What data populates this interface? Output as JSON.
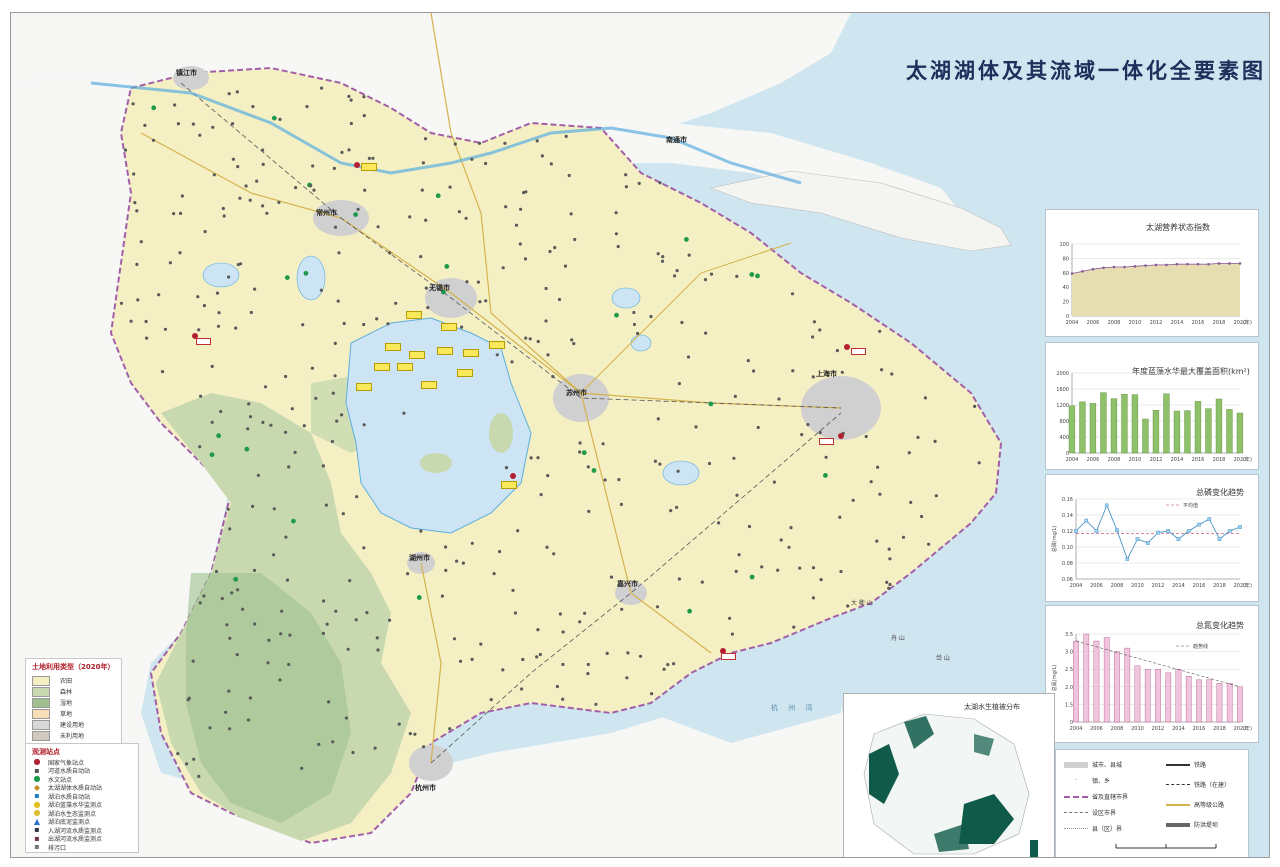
{
  "map": {
    "title": "太湖湖体及其流域一体化全要素图",
    "colors": {
      "sea": "#cfe5f0",
      "farmland": "#f5f0c4",
      "forest": "#c8d9b0",
      "forest_dark": "#9fbf8f",
      "water": "#cde4f4",
      "urban": "#d0d0d0",
      "outside": "#f7f7f5",
      "boundary": "#a25fa8",
      "road": "#d4b24c",
      "point_dark": "#5a5a5a",
      "point_green": "#1f9a4a",
      "point_red": "#b22030"
    },
    "places": [
      {
        "name": "镇江市",
        "kind": "city"
      },
      {
        "name": "常州市",
        "kind": "city"
      },
      {
        "name": "无锡市",
        "kind": "city"
      },
      {
        "name": "苏州市",
        "kind": "city"
      },
      {
        "name": "上海市",
        "kind": "city"
      },
      {
        "name": "湖州市",
        "kind": "city"
      },
      {
        "name": "嘉兴市",
        "kind": "city"
      },
      {
        "name": "杭州市",
        "kind": "city"
      },
      {
        "name": "南通市",
        "kind": "city"
      },
      {
        "name": "大 衢 山",
        "kind": "island"
      },
      {
        "name": "岱 山",
        "kind": "island"
      },
      {
        "name": "舟 山",
        "kind": "island"
      },
      {
        "name": "杭 州 湾",
        "kind": "sea"
      }
    ]
  },
  "charts": {
    "trophic_index": {
      "title": "太湖营养状态指数",
      "ylim": [
        0,
        100
      ],
      "yticks": [
        "0",
        "20",
        "40",
        "60",
        "80",
        "100"
      ],
      "xticks": [
        "2004",
        "2006",
        "2008",
        "2010",
        "2012",
        "2014",
        "2016",
        "2018",
        "2020"
      ],
      "x_unit": "(年)"
    },
    "bloom_area": {
      "title": "年度蓝藻水华最大覆盖面积(km²)",
      "yticks": [
        "0",
        "400",
        "800",
        "1200",
        "1600",
        "2000"
      ],
      "xticks": [
        "2004",
        "2006",
        "2008",
        "2010",
        "2012",
        "2014",
        "2016",
        "2018",
        "2020"
      ],
      "x_unit": "(年)"
    },
    "tp": {
      "title": "总磷变化趋势",
      "ylabel": "总磷(mg/L)",
      "legend": "平均值",
      "yticks": [
        "0.06",
        "0.08",
        "0.10",
        "0.12",
        "0.14",
        "0.16"
      ],
      "xticks": [
        "2004",
        "2006",
        "2008",
        "2010",
        "2012",
        "2014",
        "2016",
        "2018",
        "2020"
      ],
      "x_unit": "(年)"
    },
    "tn": {
      "title": "总氮变化趋势",
      "ylabel": "总氮(mg/L)",
      "legend": "趋势线",
      "yticks": [
        "0",
        "1.5",
        "2.0",
        "2.5",
        "3.0",
        "3.5"
      ],
      "xticks": [
        "2004",
        "2006",
        "2008",
        "2010",
        "2012",
        "2014",
        "2016",
        "2018",
        "2020"
      ],
      "x_unit": "(年)"
    }
  },
  "chart_data": [
    {
      "type": "area",
      "title": "太湖营养状态指数",
      "x": [
        2004,
        2005,
        2006,
        2007,
        2008,
        2009,
        2010,
        2011,
        2012,
        2013,
        2014,
        2015,
        2016,
        2017,
        2018,
        2019,
        2020
      ],
      "values": [
        59,
        62,
        65,
        67,
        68,
        68,
        69,
        70,
        71,
        71,
        72,
        72,
        72,
        72,
        73,
        73,
        73
      ],
      "ylim": [
        0,
        100
      ]
    },
    {
      "type": "bar",
      "title": "年度蓝藻水华最大覆盖面积(km²)",
      "categories": [
        "2004",
        "2005",
        "2006",
        "2007",
        "2008",
        "2009",
        "2010",
        "2011",
        "2012",
        "2013",
        "2014",
        "2015",
        "2016",
        "2017",
        "2018",
        "2019",
        "2020"
      ],
      "values": [
        1180,
        1280,
        1240,
        1510,
        1360,
        1470,
        1460,
        850,
        1070,
        1480,
        1050,
        1060,
        1290,
        1110,
        1350,
        1090,
        1000
      ],
      "ylim": [
        0,
        2000
      ]
    },
    {
      "type": "line",
      "title": "总磷变化趋势",
      "x": [
        2004,
        2005,
        2006,
        2007,
        2008,
        2009,
        2010,
        2011,
        2012,
        2013,
        2014,
        2015,
        2016,
        2017,
        2018,
        2019,
        2020
      ],
      "values": [
        0.12,
        0.133,
        0.12,
        0.152,
        0.121,
        0.085,
        0.11,
        0.105,
        0.118,
        0.12,
        0.11,
        0.12,
        0.128,
        0.135,
        0.11,
        0.12,
        0.125
      ],
      "average": 0.117,
      "ylim": [
        0.06,
        0.16
      ]
    },
    {
      "type": "bar",
      "title": "总氮变化趋势",
      "categories": [
        "2004",
        "2005",
        "2006",
        "2007",
        "2008",
        "2009",
        "2010",
        "2011",
        "2012",
        "2013",
        "2014",
        "2015",
        "2016",
        "2017",
        "2018",
        "2019",
        "2020"
      ],
      "values": [
        3.3,
        3.5,
        3.3,
        3.4,
        3.0,
        3.1,
        2.6,
        2.5,
        2.5,
        2.4,
        2.5,
        2.3,
        2.2,
        2.2,
        2.1,
        2.1,
        2.0
      ],
      "trend": [
        3.3,
        2.0
      ],
      "ylim": [
        1.0,
        3.5
      ]
    }
  ],
  "legend_landuse": {
    "title": "土地利用类型（2020年）",
    "items": [
      {
        "label": "农田",
        "color": "#f5f0c4"
      },
      {
        "label": "森林",
        "color": "#c8d9b0"
      },
      {
        "label": "湿地",
        "color": "#9fbf8f"
      },
      {
        "label": "草地",
        "color": "#f7ddb8"
      },
      {
        "label": "建设用地",
        "color": "#d8d8d8"
      },
      {
        "label": "未利用地",
        "color": "#cfcbbf"
      }
    ]
  },
  "legend_monitor": {
    "title": "观测站点",
    "items": [
      {
        "label": "国家气象站点",
        "symbol": "●",
        "color": "#b22030"
      },
      {
        "label": "河道水质自动站",
        "symbol": "▪",
        "color": "#555"
      },
      {
        "label": "水文站点",
        "symbol": "●",
        "color": "#1f9a4a"
      },
      {
        "label": "太湖湖体水质自动站",
        "symbol": "◆",
        "color": "#c09020"
      },
      {
        "label": "湖泊水质自动站",
        "symbol": "▪",
        "color": "#1d7fc4"
      },
      {
        "label": "湖泊蓝藻水华监测点",
        "symbol": "●",
        "color": "#e0c020"
      },
      {
        "label": "湖泊水生态监测点",
        "symbol": "●",
        "color": "#d8c030"
      },
      {
        "label": "湖泊底泥监测点",
        "symbol": "▲",
        "color": "#2a6fd0"
      },
      {
        "label": "入湖河流水质监测点",
        "symbol": "▪",
        "color": "#334"
      },
      {
        "label": "出湖河流水质监测点",
        "symbol": "▪",
        "color": "#703050"
      },
      {
        "label": "排污口",
        "symbol": "▪",
        "color": "#777"
      }
    ]
  },
  "inset": {
    "title": "太湖水生植被分布"
  },
  "map_legend": {
    "items_left": [
      {
        "label": "城市、县城"
      },
      {
        "label": "镇、乡"
      },
      {
        "label": "省及直辖市界"
      },
      {
        "label": "设区市界"
      },
      {
        "label": "县（区）界"
      }
    ],
    "items_right": [
      {
        "label": "铁路"
      },
      {
        "label": "铁路（在建）"
      },
      {
        "label": "高等级公路"
      },
      {
        "label": "防洪堤坝"
      }
    ]
  }
}
